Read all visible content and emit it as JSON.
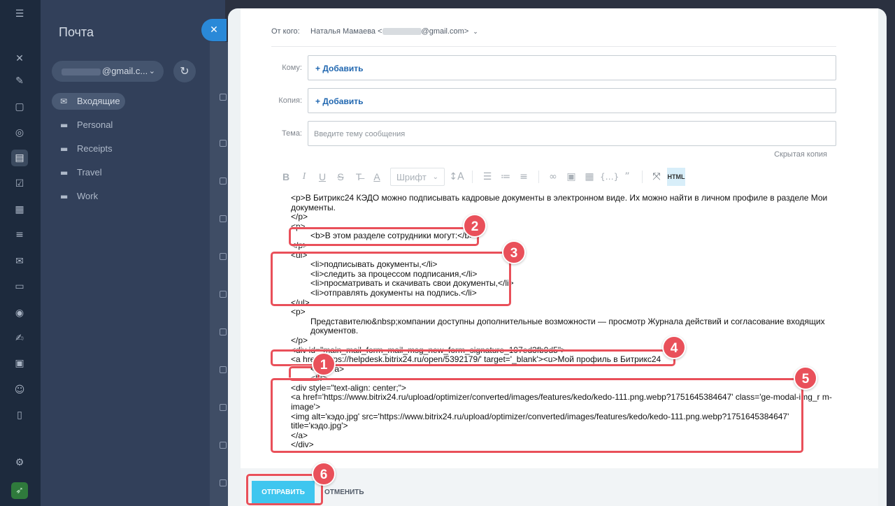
{
  "mail_panel": {
    "title": "Почта",
    "account": "@gmail.c...",
    "folders": [
      "Входящие",
      "Personal",
      "Receipts",
      "Travel",
      "Work"
    ]
  },
  "composer": {
    "from_label": "От кого:",
    "from_name": "Наталья Мамаева <",
    "from_domain": "@gmail.com>",
    "to_label": "Кому:",
    "to_add": "+ Добавить",
    "cc_label": "Копия:",
    "cc_add": "+ Добавить",
    "subject_label": "Тема:",
    "subject_placeholder": "Введите тему сообщения",
    "bcc_link": "Скрытая копия",
    "font_select": "Шрифт",
    "html_toggle": "HTML",
    "send_label": "ОТПРАВИТЬ",
    "cancel_label": "ОТМЕНИТЬ"
  },
  "editor_lines": [
    "<p>В Битрикс24 КЭДО можно подписывать кадровые документы в электронном виде. Их можно найти в личном профиле в разделе Мои документы.",
    "</p>",
    "<p>",
    "<b>В этом разделе сотрудники могут:</b>",
    "</p>",
    "<ul>",
    "<li>подписывать документы,</li>",
    "<li>следить за процессом подписания,</li>",
    "<li>просматривать и скачивать свои документы,</li>",
    "<li>отправлять документы на подпись.</li>",
    "</ul>",
    "<p>",
    "Представителю&nbsp;компании доступны дополнительные возможности — просмотр Журнала действий и согласование входящих документов.",
    "</p>",
    "<div id=\"main_mail_form_mail_msg_new_form_signature_197ed3fb9d5\">",
    "<a href='https://helpdesk.bitrix24.ru/open/5392179/' target='_blank'><u>Мой профиль в Битрикс24",
    "</u></a>",
    "<br>",
    "<div style=\"text-align: center;\">",
    "<a href='https://www.bitrix24.ru/upload/optimizer/converted/images/features/kedo/kedo-111.png.webp?1751645384647' class='ge-modal-img_r m-image'>",
    "<img alt='кэдо.jpg' src='https://www.bitrix24.ru/upload/optimizer/converted/images/features/kedo/kedo-111.png.webp?1751645384647' title='кэдо.jpg'>",
    "</a>",
    "</div>"
  ],
  "callouts": [
    "1",
    "2",
    "3",
    "4",
    "5",
    "6"
  ],
  "colors": {
    "highlight": "#e9505a",
    "send": "#3fc6ef",
    "accent": "#2067b0"
  }
}
